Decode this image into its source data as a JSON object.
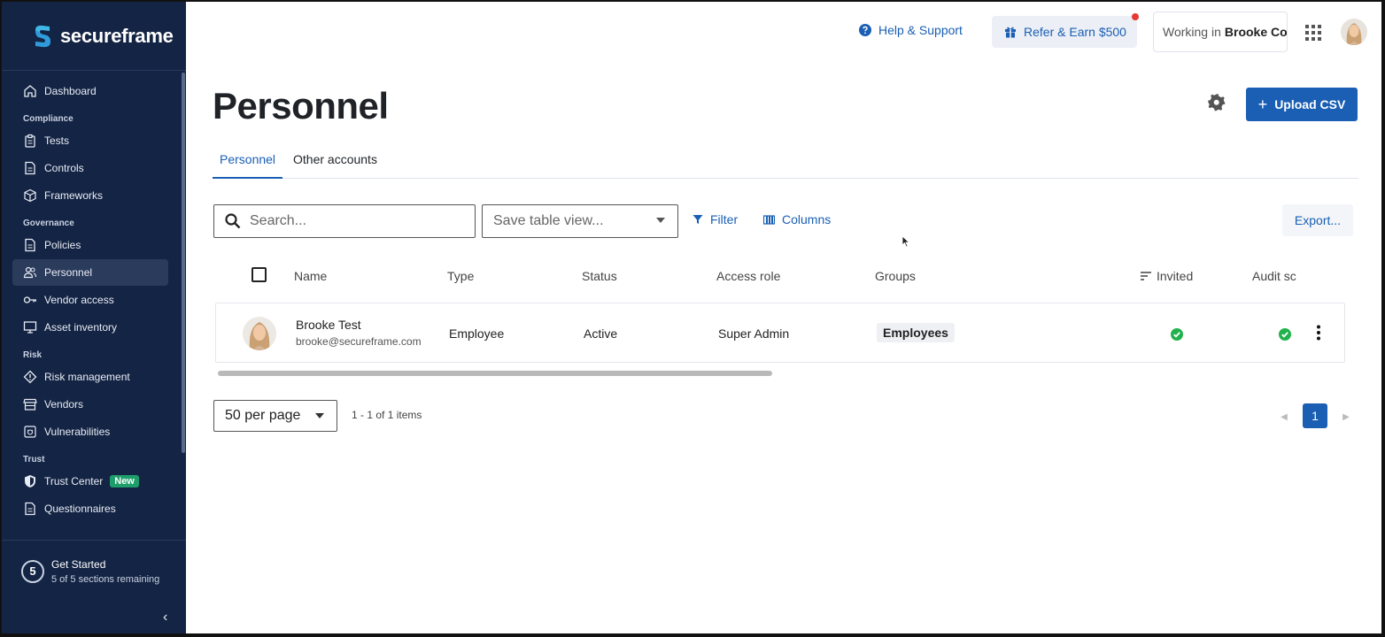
{
  "brand": {
    "name": "secureframe",
    "logo_icon": "secureframe-logo-icon"
  },
  "sidebar": {
    "top_item": {
      "label": "Dashboard",
      "icon": "home-icon"
    },
    "sections": [
      {
        "title": "Compliance",
        "items": [
          {
            "label": "Tests",
            "icon": "clipboard-icon"
          },
          {
            "label": "Controls",
            "icon": "document-icon"
          },
          {
            "label": "Frameworks",
            "icon": "cube-icon"
          }
        ]
      },
      {
        "title": "Governance",
        "items": [
          {
            "label": "Policies",
            "icon": "document-icon"
          },
          {
            "label": "Personnel",
            "icon": "people-icon",
            "active": true
          },
          {
            "label": "Vendor access",
            "icon": "key-icon"
          },
          {
            "label": "Asset inventory",
            "icon": "monitor-icon"
          }
        ]
      },
      {
        "title": "Risk",
        "items": [
          {
            "label": "Risk management",
            "icon": "diamond-icon"
          },
          {
            "label": "Vendors",
            "icon": "storefront-icon"
          },
          {
            "label": "Vulnerabilities",
            "icon": "shield-bug-icon"
          }
        ]
      },
      {
        "title": "Trust",
        "items": [
          {
            "label": "Trust Center",
            "icon": "shield-icon",
            "badge": "New"
          },
          {
            "label": "Questionnaires",
            "icon": "document-icon"
          }
        ]
      }
    ],
    "get_started": {
      "step": "5",
      "title": "Get Started",
      "subtitle": "5 of 5 sections remaining"
    },
    "collapse_icon": "chevron-left-icon"
  },
  "header": {
    "help": "Help & Support",
    "refer": "Refer & Earn $500",
    "working_prefix": "Working in",
    "working_org": "Brooke Co"
  },
  "page": {
    "title": "Personnel",
    "upload_label": "Upload CSV",
    "tabs": [
      "Personnel",
      "Other accounts"
    ]
  },
  "toolbar": {
    "search_placeholder": "Search...",
    "save_view": "Save table view...",
    "filter": "Filter",
    "columns": "Columns",
    "export": "Export..."
  },
  "table": {
    "headers": [
      "Name",
      "Type",
      "Status",
      "Access role",
      "Groups",
      "Invited",
      "Audit sc"
    ],
    "rows": [
      {
        "name": "Brooke Test",
        "email": "brooke@secureframe.com",
        "type": "Employee",
        "status": "Active",
        "access_role": "Super Admin",
        "groups": "Employees",
        "invited": true,
        "audit": true
      }
    ]
  },
  "pagination": {
    "per_page": "50 per page",
    "range": "1 - 1 of 1 items",
    "current_page": "1"
  },
  "colors": {
    "sidebar_bg": "#142444",
    "accent": "#1a5fb4",
    "success": "#22b24c",
    "badge_new": "#1e9e6a"
  }
}
